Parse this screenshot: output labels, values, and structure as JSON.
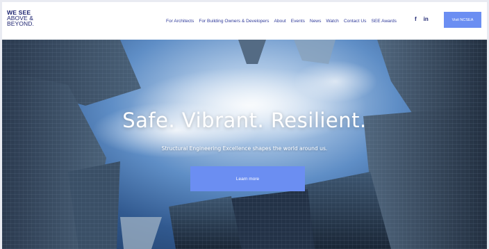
{
  "header": {
    "logo_line1": "WE SEE",
    "logo_line2": "ABOVE &",
    "logo_line3": "BEYOND.",
    "nav": [
      {
        "label": "For Architects"
      },
      {
        "label": "For Building Owners & Developers"
      },
      {
        "label": "About"
      },
      {
        "label": "Events"
      },
      {
        "label": "News"
      },
      {
        "label": "Watch"
      },
      {
        "label": "Contact Us"
      },
      {
        "label": "SEE Awards"
      }
    ],
    "social_facebook": "f",
    "social_linkedin": "in",
    "visit_button": "Visit NCSEA"
  },
  "hero": {
    "title": "Safe. Vibrant. Resilient.",
    "subtitle": "Structural Engineering Excellence shapes the world around us.",
    "button": "Learn more"
  },
  "colors": {
    "brand_navy": "#1c2370",
    "nav_text": "#2f3a9a",
    "accent": "#6b8ef2"
  }
}
